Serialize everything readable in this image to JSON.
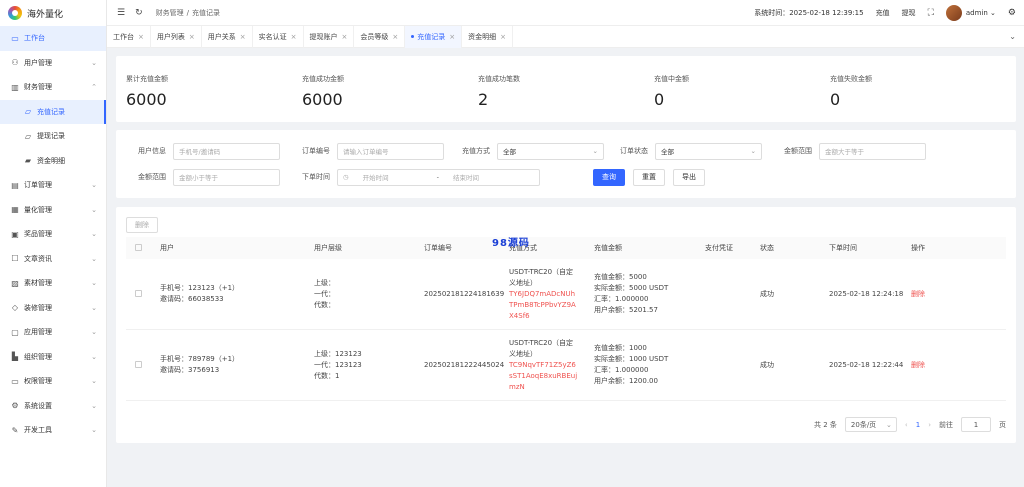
{
  "app": {
    "name": "海外量化"
  },
  "sidebar": {
    "items": [
      {
        "label": "工作台",
        "icon": "monitor-icon"
      },
      {
        "label": "用户管理",
        "icon": "user-icon"
      },
      {
        "label": "财务管理",
        "icon": "chart-icon"
      },
      {
        "label": "充值记录",
        "icon": "folder-icon"
      },
      {
        "label": "提现记录",
        "icon": "folder-icon"
      },
      {
        "label": "资金明细",
        "icon": "wallet-icon"
      },
      {
        "label": "订单管理",
        "icon": "document-icon"
      },
      {
        "label": "量化管理",
        "icon": "grid-icon"
      },
      {
        "label": "奖品管理",
        "icon": "gift-icon"
      },
      {
        "label": "文章资讯",
        "icon": "article-icon"
      },
      {
        "label": "素材管理",
        "icon": "image-icon"
      },
      {
        "label": "装修管理",
        "icon": "brush-icon"
      },
      {
        "label": "应用管理",
        "icon": "app-icon"
      },
      {
        "label": "组织管理",
        "icon": "org-icon"
      },
      {
        "label": "权限管理",
        "icon": "key-icon"
      },
      {
        "label": "系统设置",
        "icon": "gear-icon"
      },
      {
        "label": "开发工具",
        "icon": "tool-icon"
      }
    ]
  },
  "topbar": {
    "breadcrumb_parent": "财务管理",
    "breadcrumb_current": "充值记录",
    "system_time_label": "系统时间：",
    "system_time": "2025-02-18 12:39:15",
    "recharge": "充值",
    "withdraw": "提现",
    "user": "admin"
  },
  "tabs": [
    "工作台",
    "用户列表",
    "用户关系",
    "实名认证",
    "提现账户",
    "会员等级",
    "充值记录",
    "资金明细"
  ],
  "stats": [
    {
      "label": "累计充值金额",
      "value": "6000"
    },
    {
      "label": "充值成功金额",
      "value": "6000"
    },
    {
      "label": "充值成功笔数",
      "value": "2"
    },
    {
      "label": "充值中金额",
      "value": "0"
    },
    {
      "label": "充值失败金额",
      "value": "0"
    }
  ],
  "filter": {
    "user_info_label": "用户信息",
    "user_info_placeholder": "手机号/邀请码",
    "order_no_label": "订单编号",
    "order_no_placeholder": "请输入订单编号",
    "method_label": "充值方式",
    "method_value": "全部",
    "status_label": "订单状态",
    "status_value": "全部",
    "amount_label": "金额范围",
    "amount_min_placeholder": "金额大于等于",
    "amount_label2": "金额范围",
    "amount_max_placeholder": "金额小于等于",
    "time_label": "下单时间",
    "start_placeholder": "开始时间",
    "separator": "-",
    "end_placeholder": "结束时间",
    "search": "查询",
    "reset": "重置",
    "export": "导出"
  },
  "table": {
    "delete_label": "删除",
    "watermark": "98源码",
    "headers": [
      "用户",
      "用户层级",
      "订单编号",
      "充值方式",
      "充值金额",
      "支付凭证",
      "状态",
      "下单时间",
      "操作"
    ],
    "rows": [
      {
        "user_phone": "手机号：123123（+1）",
        "user_invite": "邀请码：66038533",
        "level_1": "上级：",
        "level_2": "一代：",
        "level_3": "代数：",
        "order_no": "202502181224181639",
        "method_1": "USDT-TRC20（自定",
        "method_2": "义地址）",
        "addr_1": "TY6JDQ7mADcNUh",
        "addr_2": "TPmB8TcPPbvYZ9A",
        "addr_3": "X4Sf6",
        "amt_1": "充值金额：5000",
        "amt_2": "实际金额：5000 USDT",
        "amt_3": "汇率：1.000000",
        "amt_4": "用户余额：5201.57",
        "status": "成功",
        "time": "2025-02-18 12:24:18",
        "action": "删除"
      },
      {
        "user_phone": "手机号：789789（+1）",
        "user_invite": "邀请码：3756913",
        "level_1": "上级：123123",
        "level_2": "一代：123123",
        "level_3": "代数：1",
        "order_no": "202502181222445024",
        "method_1": "USDT-TRC20（自定",
        "method_2": "义地址）",
        "addr_1": "TC9NqvTF71Z5yZ6",
        "addr_2": "sST1AoqE8xuRBEuj",
        "addr_3": "mzN",
        "amt_1": "充值金额：1000",
        "amt_2": "实际金额：1000 USDT",
        "amt_3": "汇率：1.000000",
        "amt_4": "用户余额：1200.00",
        "status": "成功",
        "time": "2025-02-18 12:22:44",
        "action": "删除"
      }
    ]
  },
  "pager": {
    "total": "共 2 条",
    "page_size": "20条/页",
    "current": "1",
    "goto_label": "前往",
    "goto_value": "1",
    "page_unit": "页"
  }
}
